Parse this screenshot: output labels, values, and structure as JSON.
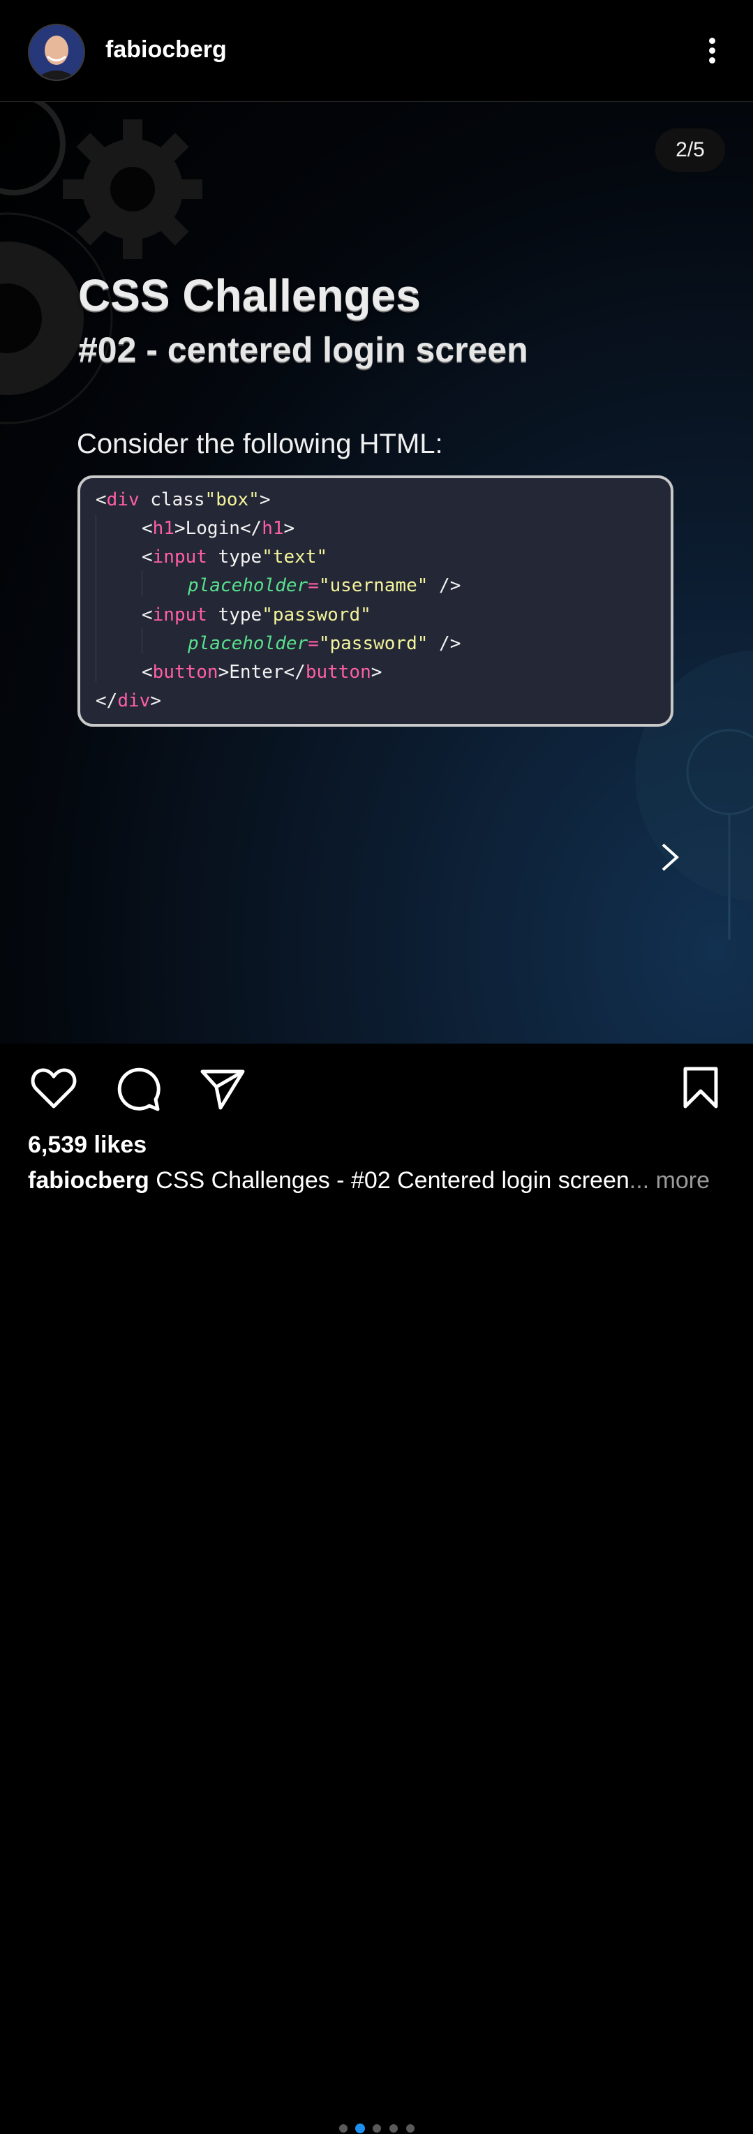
{
  "header": {
    "username": "fabiocberg"
  },
  "post": {
    "counter": "2/5",
    "title": "CSS Challenges",
    "subtitle": "#02 - centered login screen",
    "lead": "Consider the following HTML:",
    "code": [
      "<div class=\"box\">",
      "<h1>Login</h1>",
      "<input type=\"text\"",
      "placeholder=\"username\" />",
      "<input type=\"password\"",
      "placeholder=\"password\" />",
      "<button>Enter</button>",
      "</div>"
    ]
  },
  "carousel": {
    "count": 5,
    "active_index": 1
  },
  "footer": {
    "likes": "6,539 likes",
    "caption_user": "fabiocberg",
    "caption_text": "CSS Challenges - #02 Centered login screen",
    "more_label": "... more"
  },
  "icons": [
    "avatar",
    "more-vertical-icon",
    "next-arrow-icon",
    "heart-icon",
    "comment-icon",
    "share-icon",
    "bookmark-icon"
  ],
  "colors": {
    "tag": "#ff5fa8",
    "attr": "#58e08d",
    "string": "#f3f49b",
    "active_dot": "#1e8ff0"
  }
}
